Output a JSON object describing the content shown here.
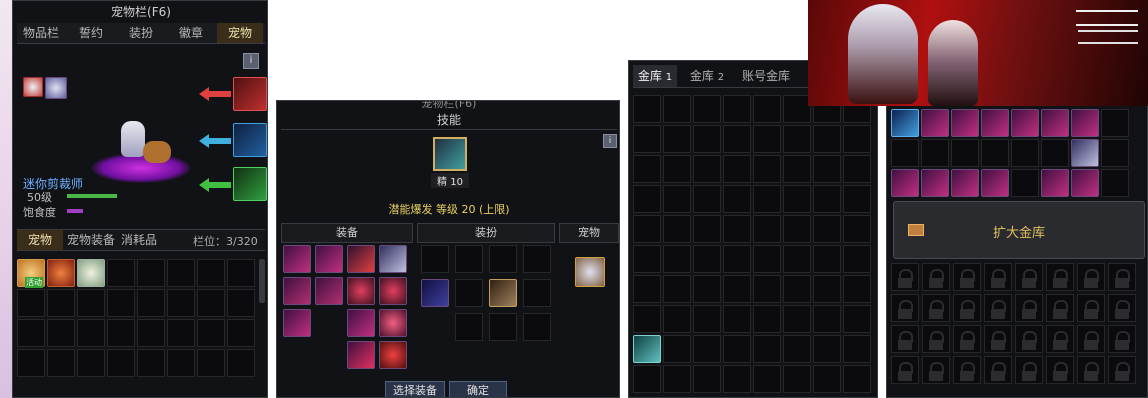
{
  "pet_window": {
    "title": "宠物栏(F6)",
    "tabs": [
      "物品栏",
      "誓约",
      "装扮",
      "徽章",
      "宠物"
    ],
    "active_tab": "宠物",
    "info_glyph": "i",
    "pet_name": "迷你剪裁师",
    "level_label": "50级",
    "satiety_label": "饱食度",
    "sub_tabs": [
      "宠物",
      "宠物装备",
      "消耗品"
    ],
    "slot_count": "栏位：3/320",
    "badge_text": "活动"
  },
  "skill_window": {
    "title": "宠物栏(F6)",
    "header": "技能",
    "skill_badge": "精 10",
    "skill_line": "潜能爆发 等级 20 (上限)",
    "info_glyph": "i",
    "sections": [
      "装备",
      "装扮",
      "宠物"
    ],
    "select_button": "选择装备",
    "confirm_button": "确定"
  },
  "vault_window": {
    "tabs": [
      "金库",
      "1",
      "金库",
      "2",
      "账号金库"
    ]
  },
  "expand_window": {
    "expand_button": "扩大金库"
  },
  "colors": {
    "panel_bg": "#111215",
    "accent_gold": "#e0c060",
    "exp_bar": "#4ab848",
    "satiety_bar": "#a040c0",
    "skill_text": "#e8d060"
  }
}
